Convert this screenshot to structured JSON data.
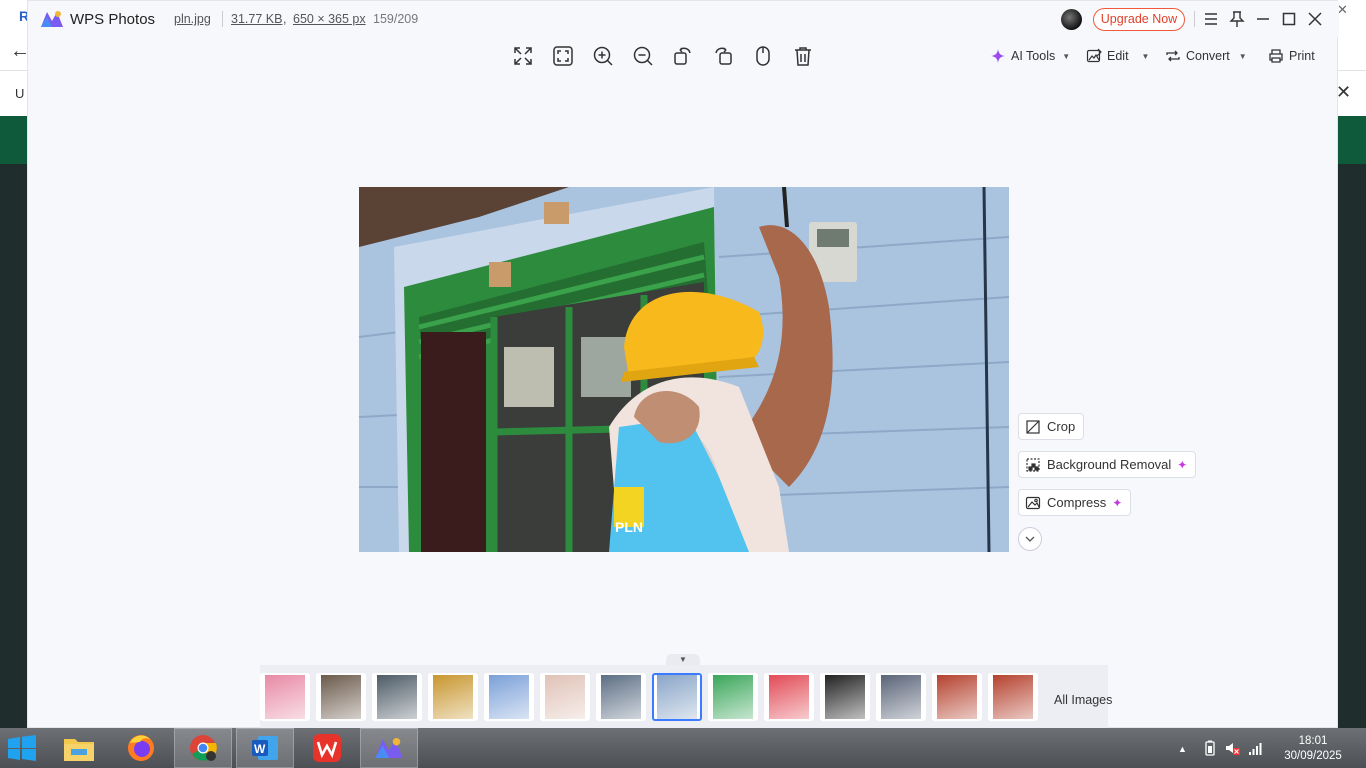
{
  "window": {
    "app_name": "WPS Photos",
    "file_name": "pln.jpg",
    "file_size": "31.77 KB",
    "comma": ",",
    "dimensions": "650 × 365 px",
    "index": "159/209",
    "upgrade_label": "Upgrade Now"
  },
  "background_app": {
    "letter_r": "R",
    "letter_u": "U",
    "close_glyph": "✕",
    "back_glyph": "←"
  },
  "toolbar": {
    "ai_tools": "AI Tools",
    "edit": "Edit",
    "convert": "Convert",
    "print": "Print"
  },
  "side_actions": {
    "crop": "Crop",
    "background_removal": "Background Removal",
    "compress": "Compress"
  },
  "filmstrip": {
    "all_images": "All Images",
    "thumbnails": [
      {
        "name": "thumb-pink-poster",
        "color": "#e88aa6"
      },
      {
        "name": "thumb-people",
        "color": "#6b5a4b"
      },
      {
        "name": "thumb-portrait",
        "color": "#4d5b66"
      },
      {
        "name": "thumb-food",
        "color": "#c8962e"
      },
      {
        "name": "thumb-illustration",
        "color": "#7ba0d8"
      },
      {
        "name": "thumb-hands",
        "color": "#e0c2b7"
      },
      {
        "name": "thumb-building",
        "color": "#5c6e84"
      },
      {
        "name": "thumb-pln",
        "color": "#8aa6c8"
      },
      {
        "name": "thumb-logo",
        "color": "#3aa65a"
      },
      {
        "name": "thumb-heart",
        "color": "#e24b56"
      },
      {
        "name": "thumb-dark-poster",
        "color": "#222222"
      },
      {
        "name": "thumb-group",
        "color": "#5a6478"
      },
      {
        "name": "thumb-man-1",
        "color": "#b5422f"
      },
      {
        "name": "thumb-man-2",
        "color": "#b5422f"
      }
    ]
  },
  "taskbar": {
    "time": "18:01",
    "date": "30/09/2025"
  },
  "photo": {
    "badge_text": "PLN"
  },
  "colors": {
    "accent": "#3b7bff",
    "upgrade": "#e0402a",
    "ai_spark": "#c33be0"
  }
}
